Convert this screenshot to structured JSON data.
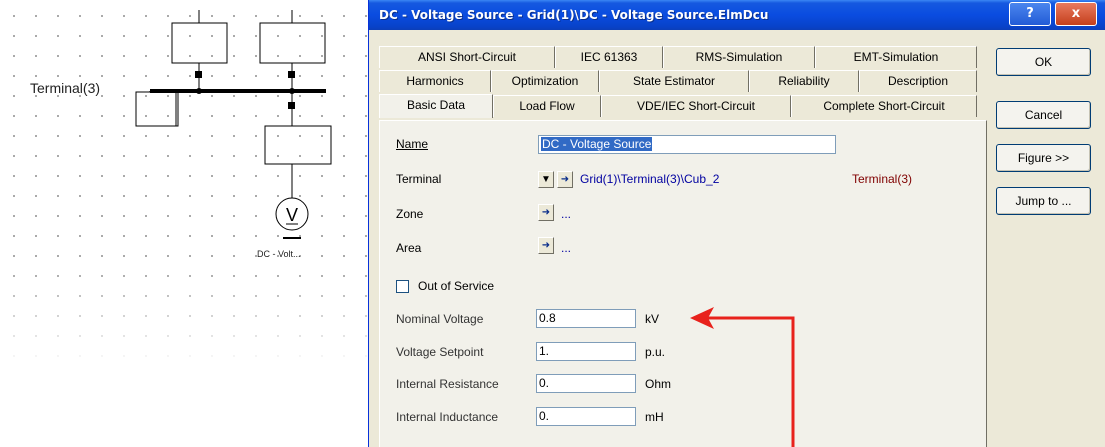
{
  "schematic": {
    "terminal_label": "Terminal(3)",
    "device_symbol": "V",
    "device_label": "DC - Volt..."
  },
  "dialog": {
    "title": "DC - Voltage Source - Grid(1)\\DC - Voltage Source.ElmDcu",
    "help_glyph": "?",
    "close_glyph": "x",
    "tabs_row1": [
      "ANSI Short-Circuit",
      "IEC 61363",
      "RMS-Simulation",
      "EMT-Simulation"
    ],
    "tabs_row2": [
      "Harmonics",
      "Optimization",
      "State Estimator",
      "Reliability",
      "Description"
    ],
    "tabs_row3": [
      "Basic Data",
      "Load Flow",
      "VDE/IEC Short-Circuit",
      "Complete Short-Circuit"
    ],
    "active_tab": "Basic Data"
  },
  "form": {
    "name_label": "Name",
    "name_value": "DC - Voltage Source",
    "terminal_label": "Terminal",
    "terminal_path": "Grid(1)\\Terminal(3)\\Cub_2",
    "terminal_name": "Terminal(3)",
    "zone_label": "Zone",
    "zone_value": "...",
    "area_label": "Area",
    "area_value": "...",
    "out_of_service_label": "Out of Service",
    "out_of_service_checked": false,
    "nominal_voltage_label": "Nominal Voltage",
    "nominal_voltage_value": "0.8",
    "nominal_voltage_unit": "kV",
    "voltage_setpoint_label": "Voltage Setpoint",
    "voltage_setpoint_value": "1.",
    "voltage_setpoint_unit": "p.u.",
    "internal_resistance_label": "Internal Resistance",
    "internal_resistance_value": "0.",
    "internal_resistance_unit": "Ohm",
    "internal_inductance_label": "Internal Inductance",
    "internal_inductance_value": "0.",
    "internal_inductance_unit": "mH"
  },
  "buttons": {
    "ok": "OK",
    "cancel": "Cancel",
    "figure": "Figure >>",
    "jump_to": "Jump to ..."
  },
  "colors": {
    "annotation_arrow": "#e8221c",
    "title_bar": "#0a4ce0",
    "selection": "#316ac5"
  }
}
